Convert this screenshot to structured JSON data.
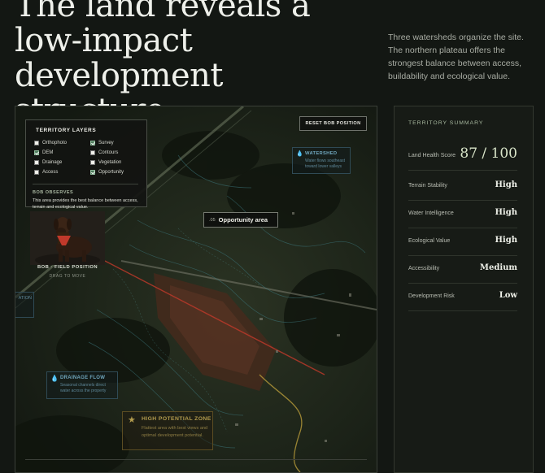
{
  "header": {
    "headline": "The land reveals a low-impact development structure.",
    "intro": "Three watersheds organize the site. The northern plateau offers the strongest balance between access, buildability and ecological value."
  },
  "layers_panel": {
    "title": "TERRITORY LAYERS",
    "items": [
      {
        "label": "Orthophoto",
        "checked": false
      },
      {
        "label": "Survey",
        "checked": true
      },
      {
        "label": "DEM",
        "checked": true
      },
      {
        "label": "Contours",
        "checked": false
      },
      {
        "label": "Drainage",
        "checked": false
      },
      {
        "label": "Vegetation",
        "checked": false
      },
      {
        "label": "Access",
        "checked": false
      },
      {
        "label": "Opportunity",
        "checked": true
      }
    ],
    "observes_title": "BOB OBSERVES",
    "observes_text": "This area provides the best balance between access, terrain and ecological value."
  },
  "map": {
    "reset_label": "RESET BOB POSITION",
    "watershed": {
      "title": "WATERSHED",
      "text": "Water flows southeast toward lower valleys"
    },
    "opportunity": {
      "number": ".05",
      "label": "Opportunity area"
    },
    "bob": {
      "caption": "BOB · FIELD POSITION",
      "sub": "DRAG TO MOVE"
    },
    "edge_tag": "ATION",
    "drainage": {
      "title": "DRAINAGE FLOW",
      "text": "Seasonal channels direct water across the property"
    },
    "high_potential": {
      "title": "HIGH POTENTIAL ZONE",
      "text": "Flattest area with best views and optimal development potential."
    }
  },
  "summary": {
    "title": "TERRITORY SUMMARY",
    "score_label": "Land Health Score",
    "score_value": "87 / 100",
    "rows": [
      {
        "label": "Terrain Stability",
        "value": "High"
      },
      {
        "label": "Water Intelligence",
        "value": "High"
      },
      {
        "label": "Ecological Value",
        "value": "High"
      },
      {
        "label": "Accessibility",
        "value": "Medium"
      },
      {
        "label": "Development Risk",
        "value": "Low"
      }
    ]
  },
  "colors": {
    "background": "#131713",
    "water_accent": "#6fa6bd",
    "gold_accent": "#b39c4e",
    "opportunity_red": "#c0392b",
    "check_green": "#4b7a5a"
  },
  "icons": {
    "watershed": "water-drop-icon",
    "drainage": "water-drop-icon",
    "high_potential": "star-icon"
  }
}
